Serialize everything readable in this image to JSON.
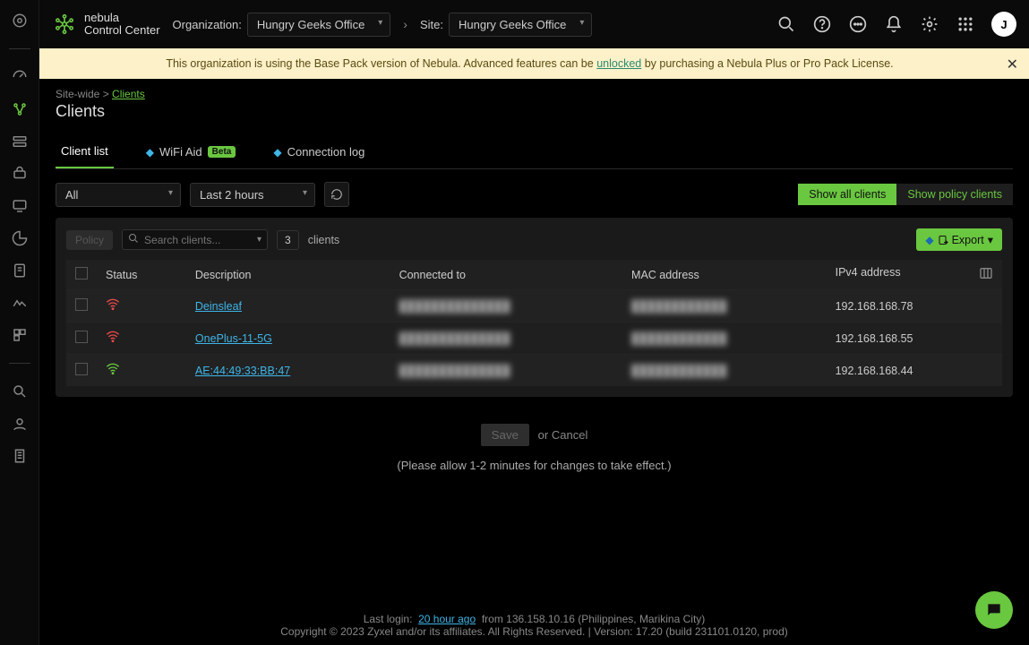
{
  "brand": {
    "line1": "nebula",
    "line2": "Control Center"
  },
  "topbar": {
    "orgLabel": "Organization:",
    "orgValue": "Hungry Geeks Office",
    "siteLabel": "Site:",
    "siteValue": "Hungry Geeks Office",
    "avatar": "J"
  },
  "banner": {
    "pre": "This organization is using the Base Pack version of Nebula. Advanced features can be ",
    "link": "unlocked",
    "post": " by purchasing a Nebula Plus or Pro Pack License."
  },
  "breadcrumb": {
    "root": "Site-wide",
    "current": "Clients"
  },
  "pageTitle": "Clients",
  "tabs": {
    "list": "Client list",
    "wifi": "WiFi Aid",
    "beta": "Beta",
    "conn": "Connection log"
  },
  "filters": {
    "all": "All",
    "range": "Last 2 hours"
  },
  "buttons": {
    "showAll": "Show all clients",
    "showPolicy": "Show policy clients",
    "policy": "Policy",
    "export": "Export",
    "save": "Save",
    "or": "or",
    "cancel": "Cancel"
  },
  "search": {
    "placeholder": "Search clients..."
  },
  "count": {
    "value": "3",
    "label": "clients"
  },
  "columns": {
    "status": "Status",
    "description": "Description",
    "connected": "Connected to",
    "mac": "MAC address",
    "ipv4": "IPv4 address"
  },
  "rows": [
    {
      "signal": "red",
      "desc": "Deinsleaf",
      "connected": "██████████████",
      "mac": "████████████",
      "ip": "192.168.168.78"
    },
    {
      "signal": "red",
      "desc": "OnePlus-11-5G",
      "connected": "██████████████",
      "mac": "████████████",
      "ip": "192.168.168.55"
    },
    {
      "signal": "green",
      "desc": "AE:44:49:33:BB:47",
      "connected": "██████████████",
      "mac": "████████████",
      "ip": "192.168.168.44"
    }
  ],
  "note": "(Please allow 1-2 minutes for changes to take effect.)",
  "footer": {
    "lastLoginLabel": "Last login:",
    "lastLoginTime": "20 hour ago",
    "lastLoginFrom": "from 136.158.10.16 (Philippines, Marikina City)",
    "copyright": "Copyright © 2023 Zyxel and/or its affiliates. All Rights Reserved. | Version: 17.20 (build 231101.0120, prod)"
  }
}
